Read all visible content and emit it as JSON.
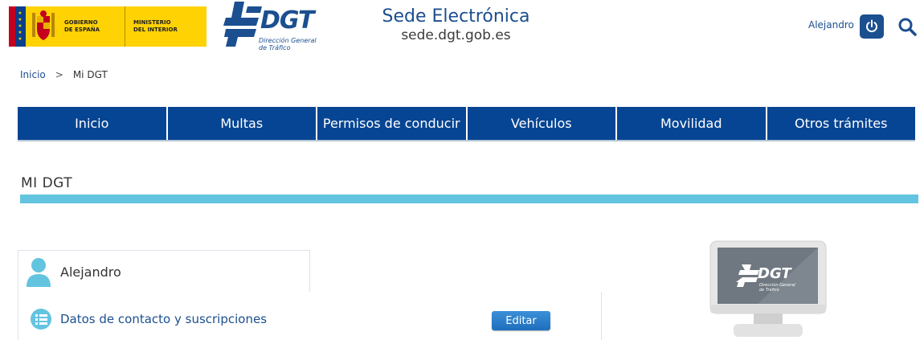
{
  "header": {
    "gov_line1a": "GOBIERNO",
    "gov_line1b": "DE ESPAÑA",
    "gov_line2a": "MINISTERIO",
    "gov_line2b": "DEL INTERIOR",
    "dgt_word": "DGT",
    "dgt_sub1": "Dirección General",
    "dgt_sub2": "de Tráfico",
    "sede_title": "Sede Electrónica",
    "sede_url": "sede.dgt.gob.es",
    "user_name": "Alejandro",
    "icons": {
      "power": "power-icon",
      "search": "search-icon"
    }
  },
  "breadcrumb": {
    "home": "Inicio",
    "separator": ">",
    "current": "Mi DGT"
  },
  "nav": {
    "items": [
      "Inicio",
      "Multas",
      "Permisos de conducir",
      "Vehículos",
      "Movilidad",
      "Otros trámites"
    ]
  },
  "page": {
    "title": "MI DGT"
  },
  "profile": {
    "name": "Alejandro",
    "contact_label": "Datos de contacto y suscripciones",
    "edit_label": "Editar"
  },
  "monitor": {
    "brand": "DGT",
    "sub1": "Dirección General",
    "sub2": "de Tráfico"
  },
  "colors": {
    "nav_bg": "#064593",
    "brand_blue": "#1b4f8f",
    "accent_bar": "#63c4e0",
    "gov_yellow": "#ffd204"
  }
}
